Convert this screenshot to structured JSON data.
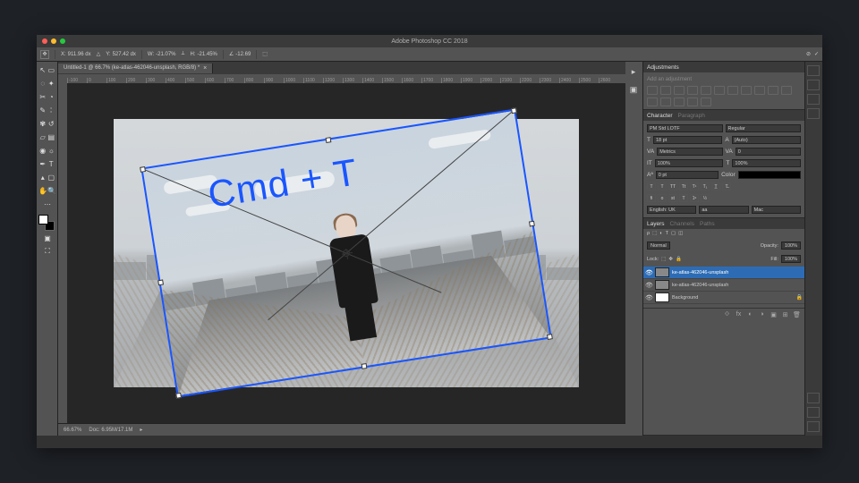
{
  "title": "Adobe Photoshop CC 2018",
  "traffic_lights": {
    "close": "close",
    "min": "minimize",
    "max": "maximize"
  },
  "optionsbar": {
    "x_label": "X:",
    "x_value": "911.96 dx",
    "y_label": "Y:",
    "y_value": "527.42 dx",
    "w_label": "W:",
    "w_value": "-21.07%",
    "h_label": "H:",
    "h_value": "-21.45%",
    "a_label": "∠",
    "a_value": "-12.69"
  },
  "document_tab": {
    "title": "Untitled-1 @ 66.7% (ke-atlas-462046-unsplash, RGB/8) *"
  },
  "ruler_ticks": [
    "-100",
    "0",
    "100",
    "200",
    "300",
    "400",
    "500",
    "600",
    "700",
    "800",
    "900",
    "1000",
    "1100",
    "1200",
    "1300",
    "1400",
    "1500",
    "1600",
    "1700",
    "1800",
    "1900",
    "2000",
    "2100",
    "2200",
    "2300",
    "2400",
    "2500",
    "2600"
  ],
  "overlay": {
    "shortcut": "Cmd + T"
  },
  "statusbar": {
    "zoom": "66.67%",
    "doc": "Doc: 6.95M/17.1M"
  },
  "adjustments": {
    "header": "Adjustments",
    "hint": "Add an adjustment"
  },
  "character": {
    "tab_character": "Character",
    "tab_paragraph": "Paragraph",
    "font": "PM Std LOTF",
    "weight": "Regular",
    "size_icon": "T",
    "size": "18 pt",
    "leading_icon": "A",
    "leading": "(Auto)",
    "tracking_icon": "VA",
    "tracking": "Metrics",
    "kerning": "0",
    "color_label": "Color",
    "scale": "100%",
    "baseline": "0 pt",
    "lang": "English: UK",
    "aa": "aa",
    "mode": "Mac"
  },
  "layers": {
    "tab_layers": "Layers",
    "tab_channels": "Channels",
    "tab_paths": "Paths",
    "blend": "Normal",
    "opacity_label": "Opacity:",
    "opacity": "100%",
    "lock_label": "Lock:",
    "fill_label": "Fill:",
    "fill": "100%",
    "items": [
      {
        "name": "ke-atlas-462046-unsplash"
      },
      {
        "name": "ke-atlas-462046-unsplash"
      },
      {
        "name": "Background"
      }
    ]
  }
}
